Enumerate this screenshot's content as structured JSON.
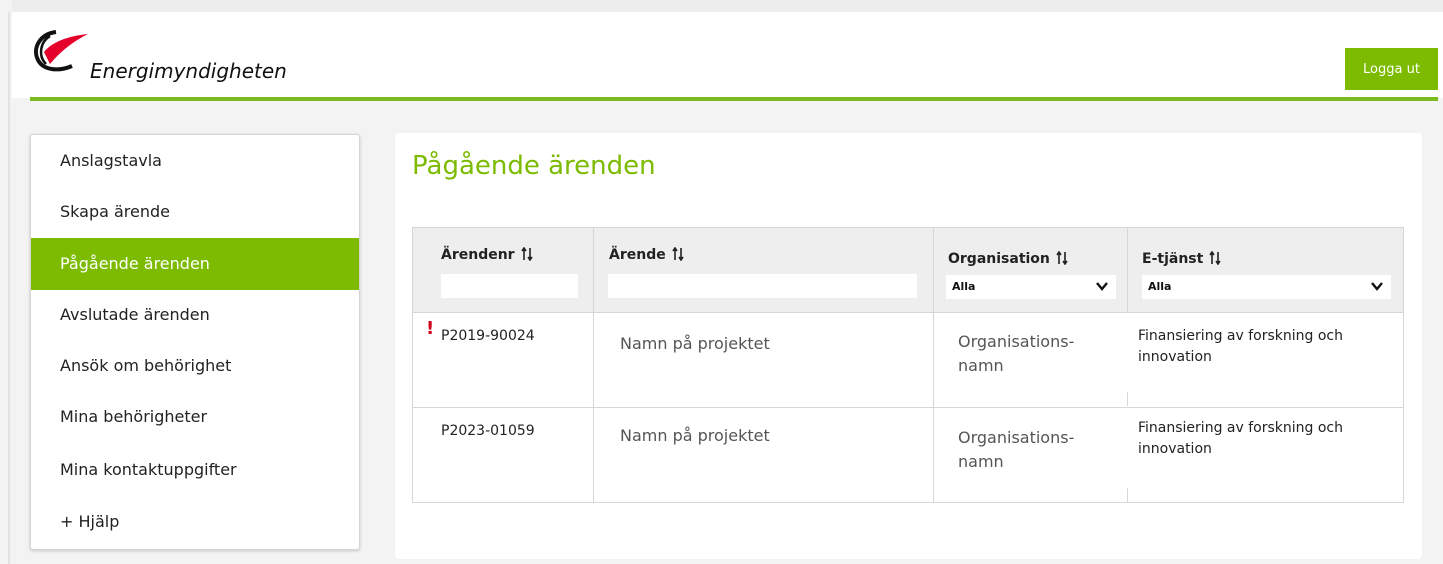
{
  "header": {
    "logo_text": "Energimyndigheten",
    "logout_label": "Logga ut"
  },
  "sidebar": {
    "items": [
      {
        "label": "Anslagstavla"
      },
      {
        "label": "Skapa ärende"
      },
      {
        "label": "Pågående ärenden",
        "active": true
      },
      {
        "label": "Avslutade ärenden"
      },
      {
        "label": "Ansök om behörighet"
      },
      {
        "label": "Mina behörigheter"
      },
      {
        "label": "Mina kontaktuppgifter"
      },
      {
        "label": "+ Hjälp"
      }
    ]
  },
  "main": {
    "title": "Pågående ärenden",
    "table": {
      "columns": [
        {
          "label": "Ärendenr",
          "filter": "text",
          "value": ""
        },
        {
          "label": "Ärende",
          "filter": "text",
          "value": ""
        },
        {
          "label": "Organisation",
          "filter": "select",
          "selected": "Alla"
        },
        {
          "label": "E-tjänst",
          "filter": "select",
          "selected": "Alla"
        }
      ],
      "rows": [
        {
          "nr": "P2019-90024",
          "flag": "!",
          "name": "Namn på projektet",
          "org": "Organisations-namn",
          "service": "Finansiering av forskning och innovation"
        },
        {
          "nr": "P2023-01059",
          "flag": "",
          "name": "Namn på projektet",
          "org": "Organisations-namn",
          "service": "Finansiering av forskning och innovation"
        }
      ]
    }
  },
  "colors": {
    "brand_green": "#7cbb00",
    "title_green": "#7cbb00",
    "alert_red": "#d0021b",
    "logo_red": "#e4002b"
  },
  "icons": {
    "logo": "energimyndigheten-logo-icon",
    "sort": "sort-arrows-icon",
    "dropdown": "chevron-down-icon",
    "alert": "exclamation-icon"
  }
}
